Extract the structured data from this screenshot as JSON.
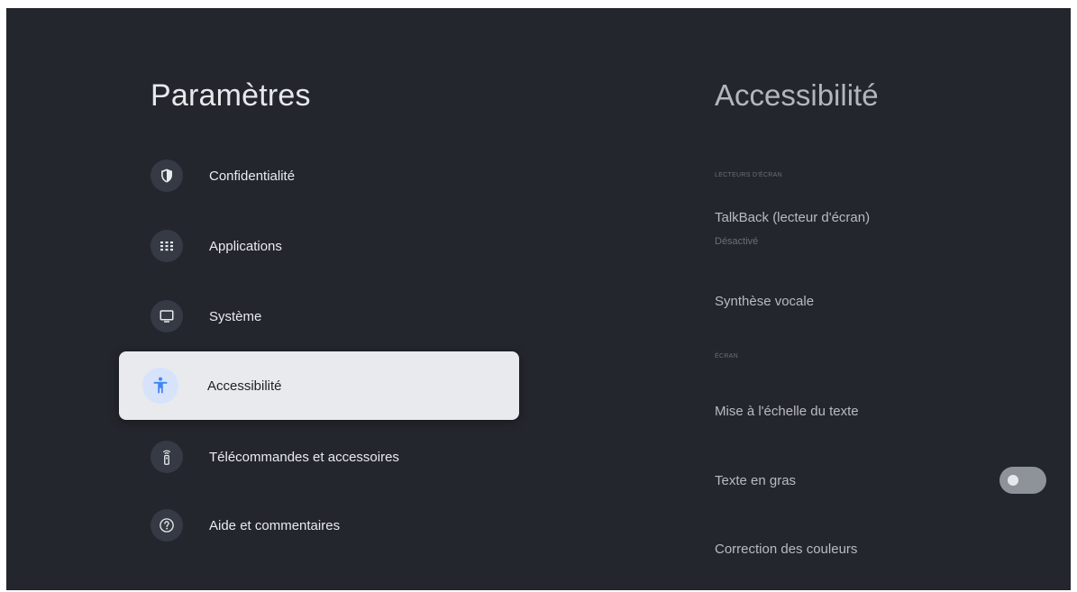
{
  "settings": {
    "title": "Paramètres",
    "items": [
      {
        "label": "Confidentialité",
        "icon": "shield-icon"
      },
      {
        "label": "Applications",
        "icon": "apps-grid-icon"
      },
      {
        "label": "Système",
        "icon": "monitor-icon"
      },
      {
        "label": "Accessibilité",
        "icon": "accessibility-icon",
        "selected": true
      },
      {
        "label": "Télécommandes et accessoires",
        "icon": "remote-icon"
      },
      {
        "label": "Aide et commentaires",
        "icon": "help-icon"
      }
    ]
  },
  "detail": {
    "title": "Accessibilité",
    "screen_readers_header": "LECTEURS D'ÉCRAN",
    "talkback": {
      "label": "TalkBack (lecteur d'écran)",
      "status": "Désactivé"
    },
    "tts_label": "Synthèse vocale",
    "screen_header": "ÉCRAN",
    "text_scaling_label": "Mise à l'échelle du texte",
    "bold_text": {
      "label": "Texte en gras",
      "enabled": false
    },
    "color_correction_label": "Correction des couleurs"
  },
  "colors": {
    "background": "#23262c",
    "selected_bg": "#e8eaed",
    "accent": "#4285f4"
  }
}
